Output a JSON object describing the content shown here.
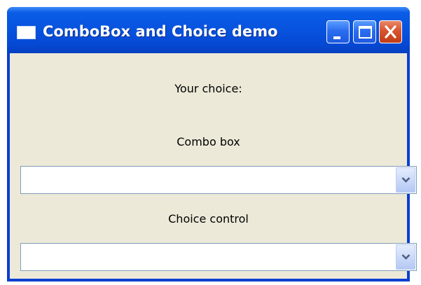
{
  "window": {
    "title": "ComboBox and Choice demo"
  },
  "titlebar_buttons": {
    "minimize": "minimize-icon",
    "maximize": "maximize-icon",
    "close": "close-icon"
  },
  "labels": {
    "your_choice": "Your choice:",
    "combo_box": "Combo box",
    "choice_control": "Choice control"
  },
  "combo_box": {
    "value": "",
    "icon": "chevron-down-icon"
  },
  "choice_control": {
    "value": "",
    "icon": "chevron-down-icon"
  },
  "colors": {
    "titlebar": "#0753de",
    "client_background": "#ece9d8",
    "close_button": "#d9532f",
    "input_border": "#7f9db9"
  }
}
